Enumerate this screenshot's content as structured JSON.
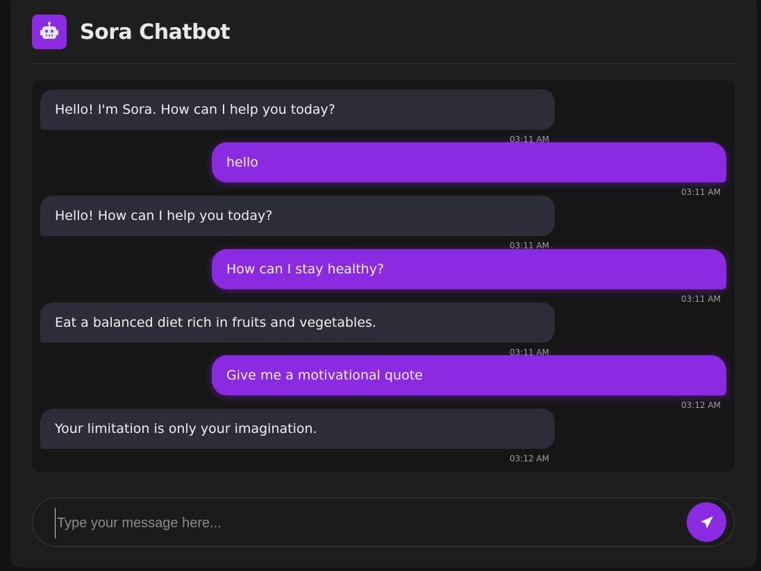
{
  "header": {
    "title": "Sora Chatbot",
    "avatar_icon": "robot-icon"
  },
  "messages": [
    {
      "sender": "bot",
      "text": "Hello! I'm Sora. How can I help you today?",
      "time": "03:11 AM"
    },
    {
      "sender": "user",
      "text": "hello",
      "time": "03:11 AM"
    },
    {
      "sender": "bot",
      "text": "Hello! How can I help you today?",
      "time": "03:11 AM"
    },
    {
      "sender": "user",
      "text": "How can I stay healthy?",
      "time": "03:11 AM"
    },
    {
      "sender": "bot",
      "text": "Eat a balanced diet rich in fruits and vegetables.",
      "time": "03:11 AM"
    },
    {
      "sender": "user",
      "text": "Give me a motivational quote",
      "time": "03:12 AM"
    },
    {
      "sender": "bot",
      "text": "Your limitation is only your imagination.",
      "time": "03:12 AM"
    }
  ],
  "composer": {
    "placeholder": "Type your message here...",
    "value": "",
    "send_icon": "paper-plane-icon"
  },
  "colors": {
    "accent": "#8a2be2",
    "background": "#1e1e1e",
    "bot_bubble": "#2d2d3a"
  }
}
